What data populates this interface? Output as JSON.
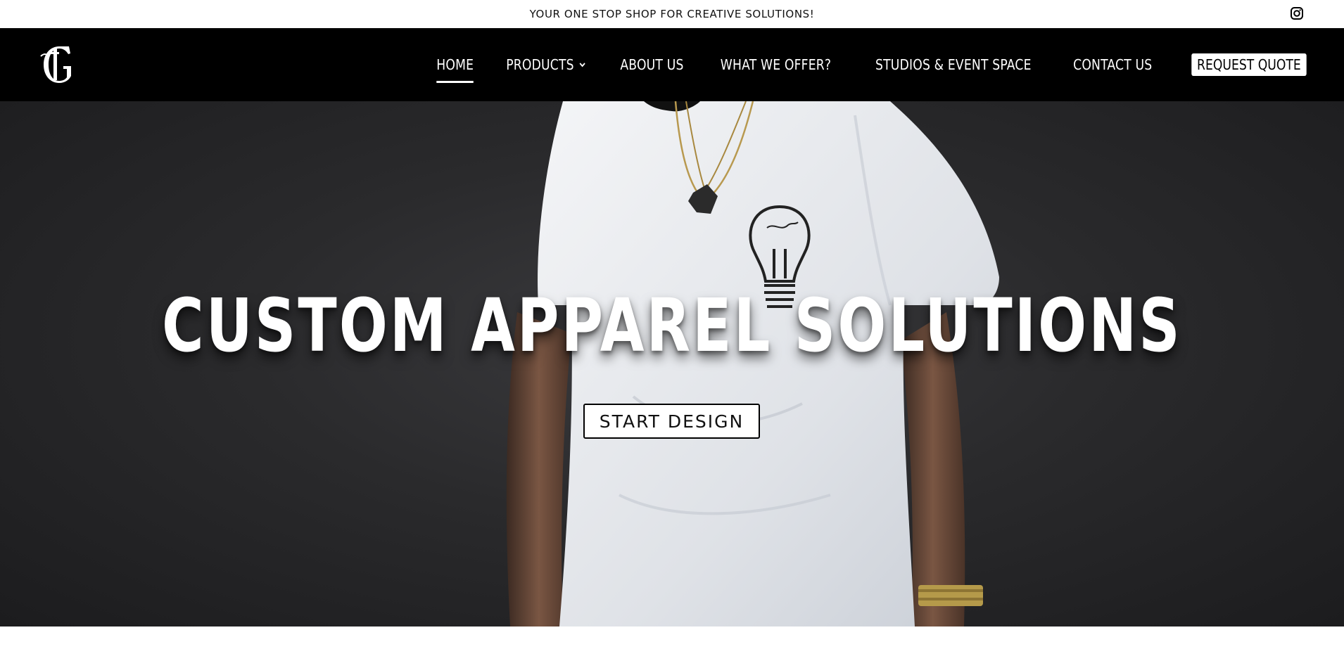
{
  "announcement": {
    "text": "YOUR ONE STOP SHOP FOR CREATIVE SOLUTIONS!"
  },
  "social": {
    "instagram_icon": "instagram-icon"
  },
  "header": {
    "logo_icon": "gothic-g-logo",
    "nav": [
      {
        "label": "HOME",
        "active": true
      },
      {
        "label": "PRODUCTS",
        "dropdown": true
      },
      {
        "label": "ABOUT US"
      },
      {
        "label": "WHAT WE OFFER?"
      },
      {
        "label": "STUDIOS & EVENT SPACE"
      },
      {
        "label": "CONTACT US"
      }
    ],
    "cta_label": "REQUEST QUOTE"
  },
  "hero": {
    "title": "CUSTOM APPAREL SOLUTIONS",
    "button_label": "START DESIGN",
    "background": "person-in-white-tshirt-with-lightbulb-print"
  },
  "colors": {
    "header_bg": "#000000",
    "hero_bg": "#2a2a2c",
    "text_light": "#ffffff"
  }
}
